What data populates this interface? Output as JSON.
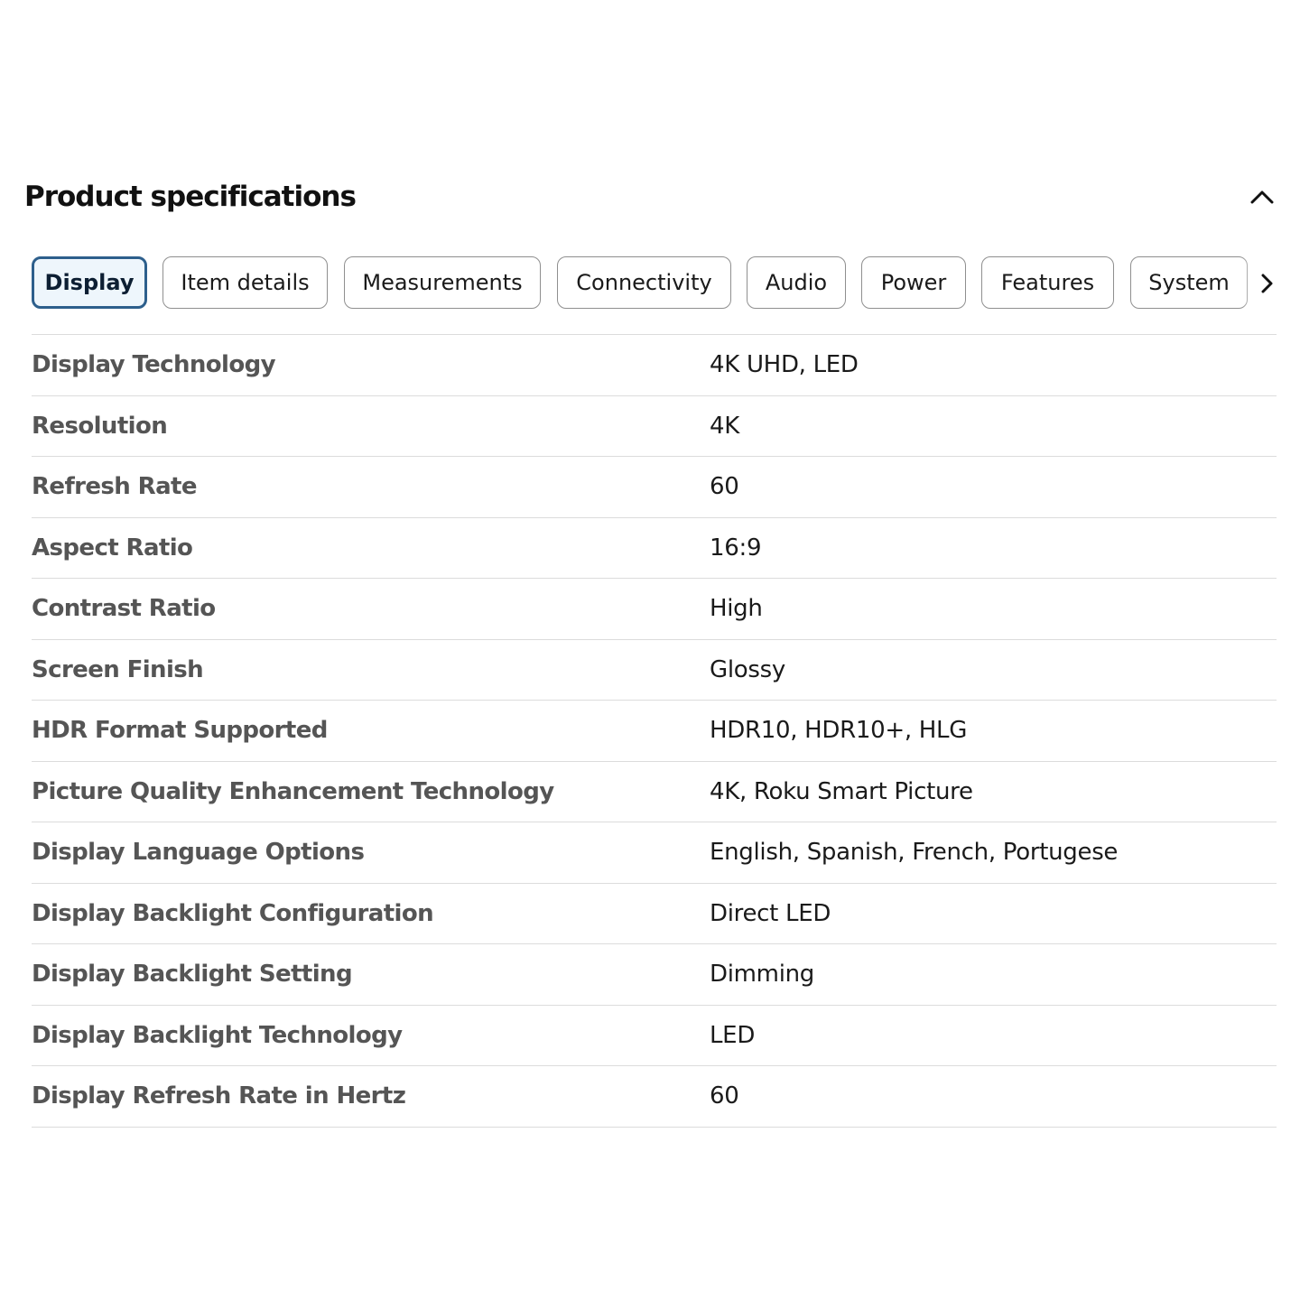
{
  "section": {
    "title": "Product specifications",
    "collapse_icon": "chevron-up-icon"
  },
  "tabs": [
    {
      "label": "Display",
      "active": true
    },
    {
      "label": "Item details",
      "active": false
    },
    {
      "label": "Measurements",
      "active": false
    },
    {
      "label": "Connectivity",
      "active": false
    },
    {
      "label": "Audio",
      "active": false
    },
    {
      "label": "Power",
      "active": false
    },
    {
      "label": "Features",
      "active": false
    },
    {
      "label": "System",
      "active": false
    }
  ],
  "tabs_next_icon": "chevron-right-icon",
  "specs": [
    {
      "name": "Display Technology",
      "value": "4K UHD, LED"
    },
    {
      "name": "Resolution",
      "value": "4K"
    },
    {
      "name": "Refresh Rate",
      "value": "60"
    },
    {
      "name": "Aspect Ratio",
      "value": "16:9"
    },
    {
      "name": "Contrast Ratio",
      "value": "High"
    },
    {
      "name": "Screen Finish",
      "value": "Glossy"
    },
    {
      "name": "HDR Format Supported",
      "value": "HDR10, HDR10+, HLG"
    },
    {
      "name": "Picture Quality Enhancement Technology",
      "value": "4K, Roku Smart Picture"
    },
    {
      "name": "Display Language Options",
      "value": "English, Spanish, French, Portugese"
    },
    {
      "name": "Display Backlight Configuration",
      "value": "Direct LED"
    },
    {
      "name": "Display Backlight Setting",
      "value": "Dimming"
    },
    {
      "name": "Display Backlight Technology",
      "value": "LED"
    },
    {
      "name": "Display Refresh Rate in Hertz",
      "value": "60"
    }
  ],
  "colors": {
    "active_tab_border": "#2d5f8c",
    "active_tab_background": "#eef6fc",
    "label_text": "#555555",
    "divider": "#dcdcdc"
  }
}
